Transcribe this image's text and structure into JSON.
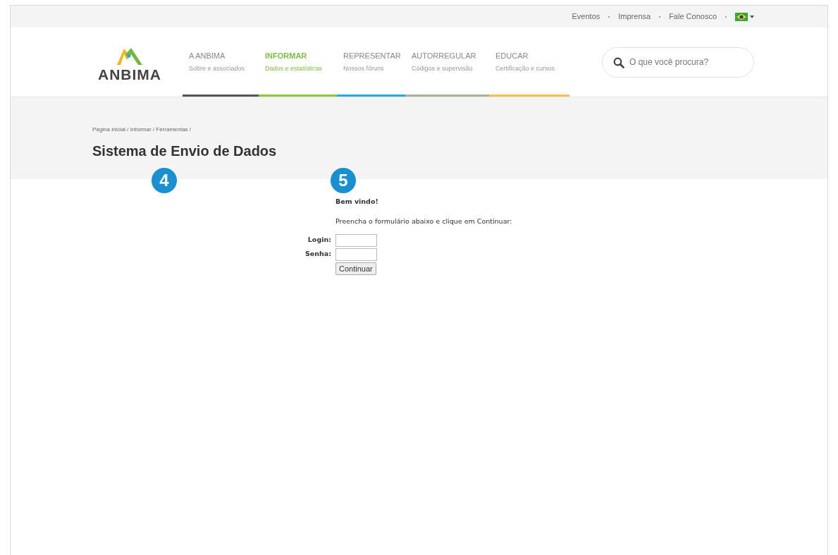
{
  "top_links": [
    "Eventos",
    "Imprensa",
    "Fale Conosco"
  ],
  "logo": {
    "text": "ANBIMA"
  },
  "nav": [
    {
      "title": "A ANBIMA",
      "subtitle": "Sobre e associados",
      "selected": false,
      "color": "#555555"
    },
    {
      "title": "INFORMAR",
      "subtitle": "Dados e estatísticas",
      "selected": true,
      "color": "#8dc63f"
    },
    {
      "title": "REPRESENTAR",
      "subtitle": "Nossos fóruns",
      "selected": false,
      "color": "#29a8e0"
    },
    {
      "title": "AUTORREGULAR",
      "subtitle": "Códigos e supervisão",
      "selected": false,
      "color": "#a9b39c"
    },
    {
      "title": "EDUCAR",
      "subtitle": "Certificação e cursos",
      "selected": false,
      "color": "#f2c14e"
    }
  ],
  "search": {
    "placeholder": "O que você procura?"
  },
  "breadcrumb": "Página inicial / Informar / Ferramentas /",
  "page_title": "Sistema de Envio de Dados",
  "callouts": [
    "4",
    "5"
  ],
  "form": {
    "welcome": "Bem vindo!",
    "instructions": "Preencha o formulário abaixo e clique em Continuar:",
    "fields": [
      {
        "label": "Login:"
      },
      {
        "label": "Senha:"
      }
    ],
    "button": "Continuar"
  }
}
